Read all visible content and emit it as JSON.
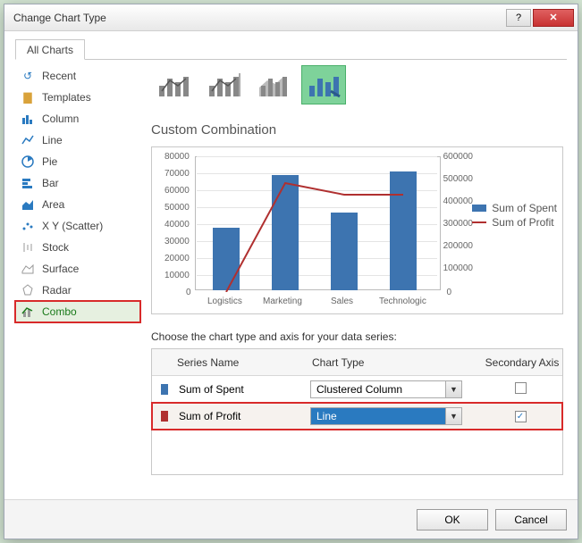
{
  "dialog": {
    "title": "Change Chart Type"
  },
  "tab": "All Charts",
  "sidebar": {
    "items": [
      {
        "label": "Recent"
      },
      {
        "label": "Templates"
      },
      {
        "label": "Column"
      },
      {
        "label": "Line"
      },
      {
        "label": "Pie"
      },
      {
        "label": "Bar"
      },
      {
        "label": "Area"
      },
      {
        "label": "X Y (Scatter)"
      },
      {
        "label": "Stock"
      },
      {
        "label": "Surface"
      },
      {
        "label": "Radar"
      },
      {
        "label": "Combo"
      }
    ]
  },
  "section_title": "Custom Combination",
  "choose_label": "Choose the chart type and axis for your data series:",
  "grid": {
    "headers": {
      "name": "Series Name",
      "type": "Chart Type",
      "axis": "Secondary Axis"
    },
    "rows": [
      {
        "swatch": "#3d74b0",
        "name": "Sum of Spent",
        "type": "Clustered Column",
        "secondary": false
      },
      {
        "swatch": "#b03030",
        "name": "Sum of Profit",
        "type": "Line",
        "secondary": true
      }
    ]
  },
  "buttons": {
    "ok": "OK",
    "cancel": "Cancel"
  },
  "chart_data": {
    "type": "combo",
    "categories": [
      "Logistics",
      "Marketing",
      "Sales",
      "Technologic"
    ],
    "series": [
      {
        "name": "Sum of Spent",
        "type": "bar",
        "axis": "primary",
        "values": [
          37000,
          68000,
          46000,
          70000
        ],
        "color": "#3d74b0"
      },
      {
        "name": "Sum of Profit",
        "type": "line",
        "axis": "secondary",
        "values": [
          0,
          480000,
          430000,
          430000
        ],
        "color": "#b03030"
      }
    ],
    "ylim_primary": [
      0,
      80000
    ],
    "ylim_secondary": [
      0,
      600000
    ],
    "yticks_primary": [
      0,
      10000,
      20000,
      30000,
      40000,
      50000,
      60000,
      70000,
      80000
    ],
    "yticks_secondary": [
      0,
      100000,
      200000,
      300000,
      400000,
      500000,
      600000
    ],
    "legend": [
      "Sum of Spent",
      "Sum of Profit"
    ]
  }
}
